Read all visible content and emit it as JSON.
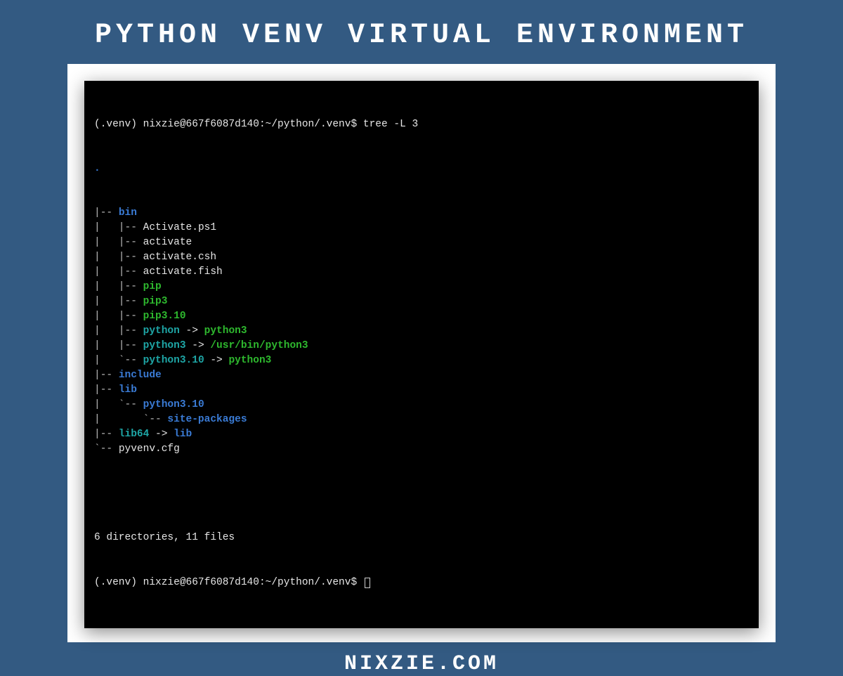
{
  "title": "PYTHON VENV VIRTUAL ENVIRONMENT",
  "footer": "NIXZIE.COM",
  "terminal": {
    "prompt1": "(.venv) nixzie@667f6087d140:~/python/.venv$ ",
    "command": "tree -L 3",
    "root_dot": ".",
    "lines": [
      {
        "prefix": "|-- ",
        "name": "bin",
        "cls": "blue"
      },
      {
        "prefix": "|   |-- ",
        "name": "Activate.ps1",
        "cls": "white"
      },
      {
        "prefix": "|   |-- ",
        "name": "activate",
        "cls": "white"
      },
      {
        "prefix": "|   |-- ",
        "name": "activate.csh",
        "cls": "white"
      },
      {
        "prefix": "|   |-- ",
        "name": "activate.fish",
        "cls": "white"
      },
      {
        "prefix": "|   |-- ",
        "name": "pip",
        "cls": "green"
      },
      {
        "prefix": "|   |-- ",
        "name": "pip3",
        "cls": "green"
      },
      {
        "prefix": "|   |-- ",
        "name": "pip3.10",
        "cls": "green"
      },
      {
        "prefix": "|   |-- ",
        "name": "python",
        "cls": "cyan",
        "arrow": " -> ",
        "target": "python3",
        "tcls": "green"
      },
      {
        "prefix": "|   |-- ",
        "name": "python3",
        "cls": "cyan",
        "arrow": " -> ",
        "target": "/usr/bin/python3",
        "tcls": "green"
      },
      {
        "prefix": "|   `-- ",
        "name": "python3.10",
        "cls": "cyan",
        "arrow": " -> ",
        "target": "python3",
        "tcls": "green"
      },
      {
        "prefix": "|-- ",
        "name": "include",
        "cls": "blue"
      },
      {
        "prefix": "|-- ",
        "name": "lib",
        "cls": "blue"
      },
      {
        "prefix": "|   `-- ",
        "name": "python3.10",
        "cls": "blue"
      },
      {
        "prefix": "|       `-- ",
        "name": "site-packages",
        "cls": "blue"
      },
      {
        "prefix": "|-- ",
        "name": "lib64",
        "cls": "cyan",
        "arrow": " -> ",
        "target": "lib",
        "tcls": "blue"
      },
      {
        "prefix": "`-- ",
        "name": "pyvenv.cfg",
        "cls": "white"
      }
    ],
    "summary": "6 directories, 11 files",
    "prompt2": "(.venv) nixzie@667f6087d140:~/python/.venv$ "
  }
}
